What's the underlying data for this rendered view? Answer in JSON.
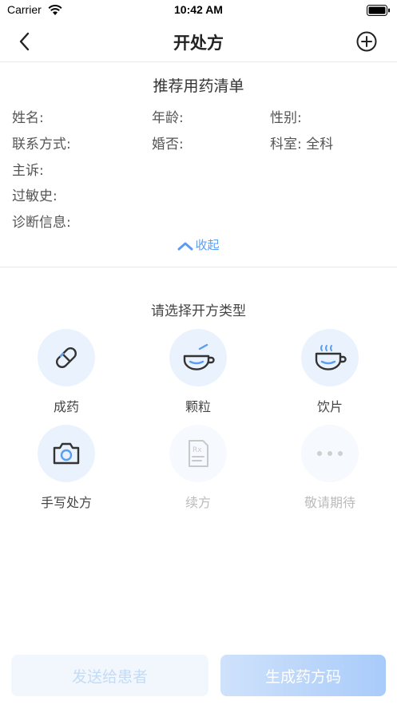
{
  "status_bar": {
    "carrier": "Carrier",
    "time": "10:42 AM"
  },
  "nav": {
    "title": "开处方"
  },
  "card": {
    "title": "推荐用药清单",
    "fields": {
      "name": "姓名:",
      "age": "年龄:",
      "gender": "性别:",
      "contact": "联系方式:",
      "marital": "婚否:",
      "department": "科室:  全科",
      "complaint": "主诉:",
      "allergy": "过敏史:",
      "diagnosis": "诊断信息:"
    },
    "collapse_label": "收起"
  },
  "types": {
    "label": "请选择开方类型",
    "items": [
      {
        "label": "成药",
        "icon": "pill-icon",
        "enabled": true
      },
      {
        "label": "颗粒",
        "icon": "granule-bowl-icon",
        "enabled": true
      },
      {
        "label": "饮片",
        "icon": "decoction-pot-icon",
        "enabled": true
      },
      {
        "label": "手写处方",
        "icon": "camera-icon",
        "enabled": true
      },
      {
        "label": "续方",
        "icon": "rx-document-icon",
        "enabled": false
      },
      {
        "label": "敬请期待",
        "icon": "more-dots-icon",
        "enabled": false
      }
    ]
  },
  "actions": {
    "send_label": "发送给患者",
    "generate_label": "生成药方码"
  },
  "colors": {
    "accent": "#5b9df0",
    "icon_stroke": "#333333",
    "circle_bg": "#eaf3fd"
  }
}
